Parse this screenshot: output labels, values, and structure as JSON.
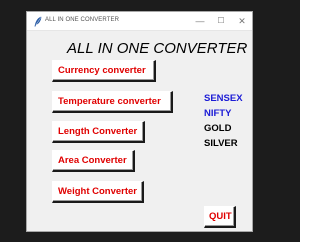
{
  "window": {
    "title": "ALL IN ONE CONVERTER",
    "icon": "feather-icon",
    "controls": {
      "minimize": "—",
      "maximize": "☐",
      "close": "✕"
    }
  },
  "main": {
    "heading": "ALL IN ONE CONVERTER",
    "buttons": {
      "currency": "Currency converter",
      "temperature": "Temperature converter",
      "length": "Length Converter",
      "area": "Area Converter",
      "weight": "Weight Converter",
      "quit": "QUIT"
    },
    "side_labels": {
      "sensex": "SENSEX",
      "nifty": "NIFTY",
      "gold": "GOLD",
      "silver": "SILVER"
    }
  },
  "colors": {
    "button_text": "#e00000",
    "index_labels": "#1c1cd6",
    "commodity_labels": "#000000",
    "background": "#1c1c1c",
    "window": "#f0f0f0"
  }
}
